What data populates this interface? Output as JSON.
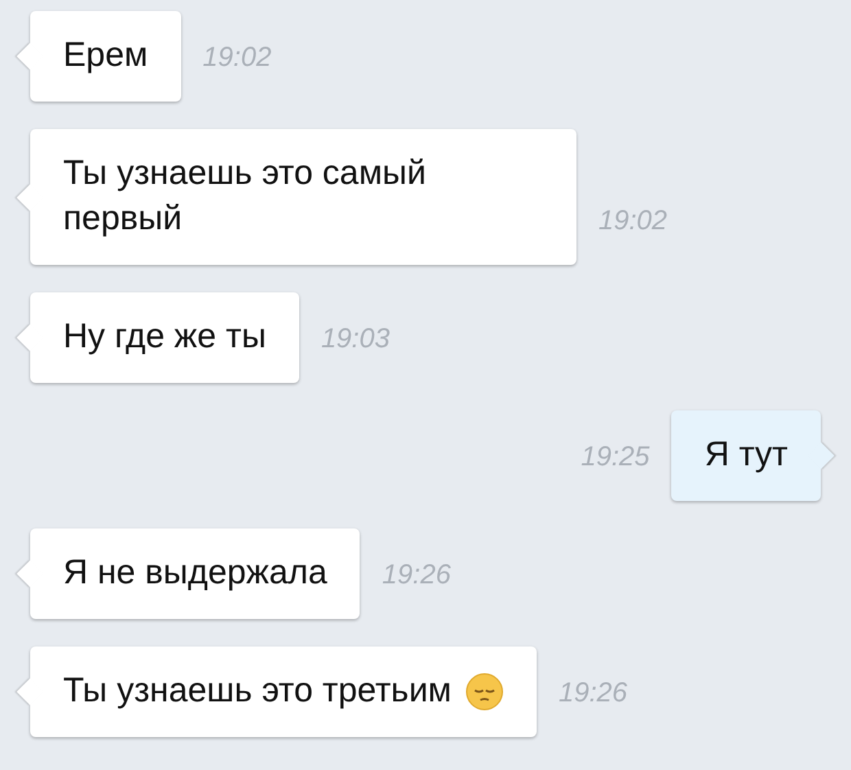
{
  "messages": [
    {
      "kind": "text",
      "outgoing": false,
      "text": "Ерем",
      "time": "19:02"
    },
    {
      "kind": "text",
      "outgoing": false,
      "text": "Ты узнаешь это самый первый",
      "time": "19:02"
    },
    {
      "kind": "text",
      "outgoing": false,
      "text": "Ну где же ты",
      "time": "19:03"
    },
    {
      "kind": "text",
      "outgoing": true,
      "text": "Я тут",
      "time": "19:25"
    },
    {
      "kind": "text",
      "outgoing": false,
      "text": "Я не выдержала",
      "time": "19:26"
    },
    {
      "kind": "text_with_emoji",
      "outgoing": false,
      "text": "Ты узнаешь это третьим",
      "time": "19:26"
    }
  ]
}
